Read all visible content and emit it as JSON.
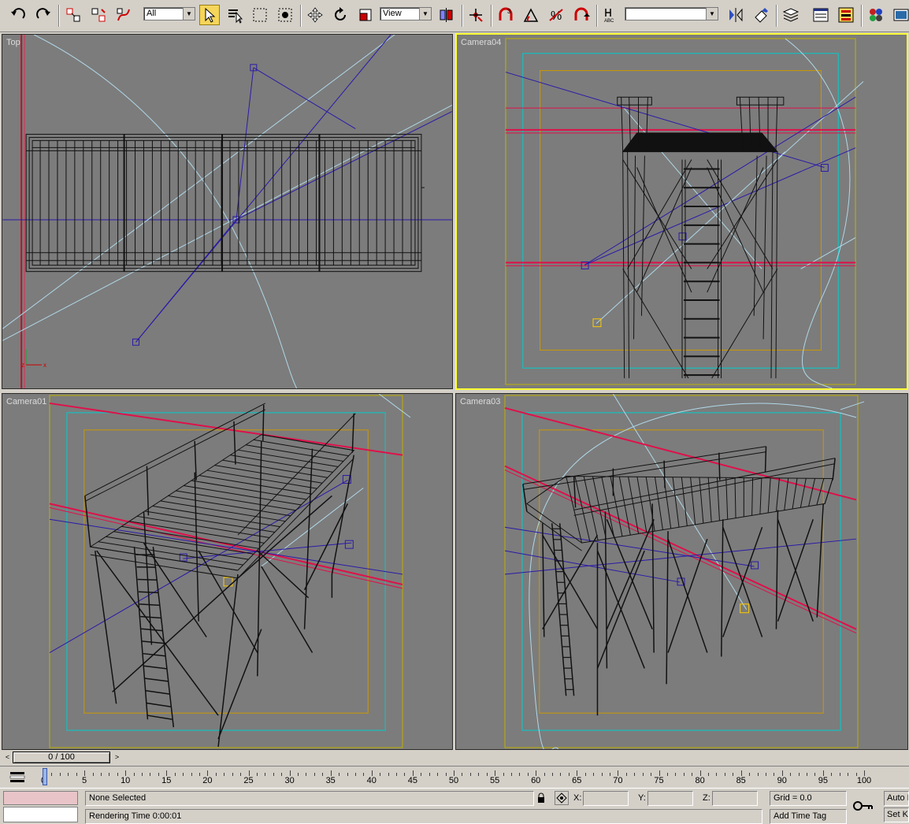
{
  "toolbar": {
    "selection_filter": "All",
    "reference_coord": "View",
    "named_selection": "",
    "buttons": [
      {
        "name": "undo-icon"
      },
      {
        "name": "redo-icon"
      },
      {
        "name": "select-and-link-icon"
      },
      {
        "name": "unlink-selection-icon"
      },
      {
        "name": "bind-to-space-warp-icon"
      },
      {
        "name": "select-object-icon"
      },
      {
        "name": "select-by-name-icon"
      },
      {
        "name": "rectangular-selection-icon"
      },
      {
        "name": "window-crossing-icon"
      },
      {
        "name": "select-and-move-icon"
      },
      {
        "name": "select-and-rotate-icon"
      },
      {
        "name": "select-and-scale-icon"
      },
      {
        "name": "use-pivot-center-icon"
      },
      {
        "name": "select-and-manipulate-icon"
      },
      {
        "name": "snap-3d-icon"
      },
      {
        "name": "angle-snap-icon"
      },
      {
        "name": "percent-snap-icon"
      },
      {
        "name": "spinner-snap-icon"
      },
      {
        "name": "edit-named-selection-icon"
      },
      {
        "name": "mirror-icon"
      },
      {
        "name": "align-icon"
      },
      {
        "name": "layer-manager-icon"
      },
      {
        "name": "curve-editor-icon"
      },
      {
        "name": "schematic-view-icon"
      },
      {
        "name": "material-editor-icon"
      },
      {
        "name": "render-scene-icon"
      }
    ]
  },
  "viewports": {
    "top": {
      "label": "Top"
    },
    "camera04": {
      "label": "Camera04",
      "selected": true
    },
    "camera01": {
      "label": "Camera01"
    },
    "camera03": {
      "label": "Camera03"
    }
  },
  "axis_tripod": {
    "x": "x",
    "z": "z"
  },
  "time_slider": {
    "value": "0 / 100",
    "prev": "<",
    "next": ">"
  },
  "track_bar": {
    "labels": [
      "0",
      "5",
      "10",
      "15",
      "20",
      "25",
      "30",
      "35",
      "40",
      "45",
      "50",
      "55",
      "60",
      "65",
      "70",
      "75",
      "80",
      "85",
      "90",
      "95",
      "100"
    ]
  },
  "status": {
    "selection": "None Selected",
    "prompt": "Rendering Time  0:00:01",
    "x_label": "X:",
    "y_label": "Y:",
    "z_label": "Z:",
    "grid": "Grid = 0.0",
    "add_time_tag": "Add Time Tag",
    "auto_key": "Auto K",
    "set_key": "Set K"
  },
  "colors": {
    "viewport_bg": "#7c7c7c",
    "selected_border": "#ffff33",
    "safe_frame_cyan": "#00cccc",
    "safe_frame_orange": "#cc9900",
    "light_lines": "#b0d8e8",
    "camera_lines": "#2a1aa8",
    "pink_lines": "#e0104a"
  }
}
